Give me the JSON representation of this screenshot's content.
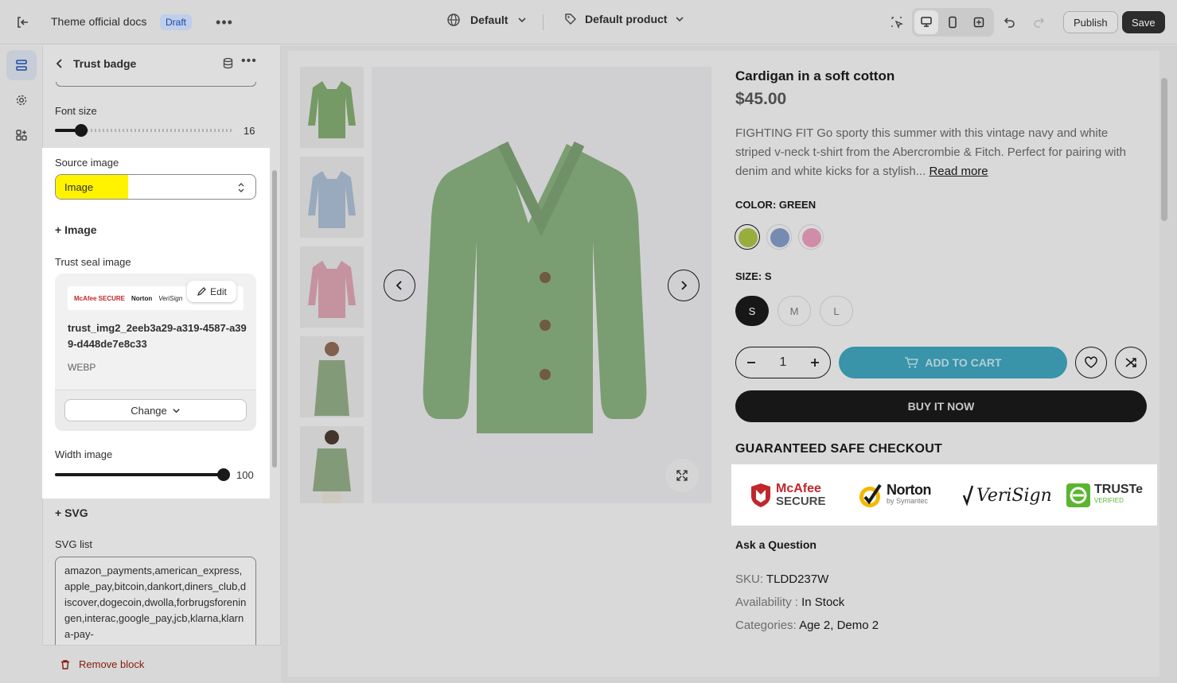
{
  "topbar": {
    "theme_name": "Theme official docs",
    "status_badge": "Draft",
    "template_select": "Default",
    "product_select": "Default product",
    "publish_label": "Publish",
    "save_label": "Save"
  },
  "panel": {
    "title": "Trust badge",
    "font_size": {
      "label": "Font size",
      "value": "16",
      "fraction": 0.14
    },
    "source_image": {
      "label": "Source image",
      "value": "Image"
    },
    "add_image_label": "+ Image",
    "trust_seal": {
      "label": "Trust seal image",
      "edit_label": "Edit",
      "file_name": "trust_img2_2eeb3a29-a319-4587-a399-d448de7e8c33",
      "file_type": "WEBP",
      "change_label": "Change",
      "thumb_brands": [
        "McAfee SECURE",
        "Norton",
        "VeriSign"
      ]
    },
    "width_image": {
      "label": "Width image",
      "value": "100",
      "fraction": 1.0
    },
    "add_svg_label": "+ SVG",
    "svg_list": {
      "label": "SVG list",
      "value": "amazon_payments,american_express,apple_pay,bitcoin,dankort,diners_club,discover,dogecoin,dwolla,forbrugsforeningen,interac,google_pay,jcb,klarna,klarna-pay-"
    },
    "remove_label": "Remove block"
  },
  "product": {
    "title": "Cardigan in a soft cotton",
    "price": "$45.00",
    "description": "FIGHTING FIT Go sporty this summer with this vintage navy and white striped v-neck t-shirt from the Abercrombie & Fitch. Perfect for pairing with denim and white kicks for a stylish...",
    "read_more": "Read more",
    "color_label": "COLOR: GREEN",
    "colors": [
      "#a4bc42",
      "#7f97c2",
      "#e29ab8"
    ],
    "size_label": "SIZE: S",
    "sizes": [
      "S",
      "M",
      "L"
    ],
    "quantity": "1",
    "add_to_cart": "ADD TO CART",
    "buy_now": "BUY IT NOW",
    "guarantee": "GUARANTEED SAFE CHECKOUT",
    "trust_logos": [
      {
        "name": "McAfee",
        "sub": "SECURE"
      },
      {
        "name": "Norton",
        "sub": "by Symantec"
      },
      {
        "name": "VeriSign",
        "sub": ""
      },
      {
        "name": "TRUSTe",
        "sub": "VERIFIED"
      }
    ],
    "ask_question": "Ask a Question",
    "sku_label": "SKU:",
    "sku_value": "TLDD237W",
    "availability_label": "Availability :",
    "availability_value": "In Stock",
    "categories_label": "Categories:",
    "categories_value": "Age 2, Demo 2"
  },
  "colors": {
    "highlight": "#fff300",
    "accent_cart": "#3ea0b8",
    "remove_red": "#8e1f0b"
  }
}
